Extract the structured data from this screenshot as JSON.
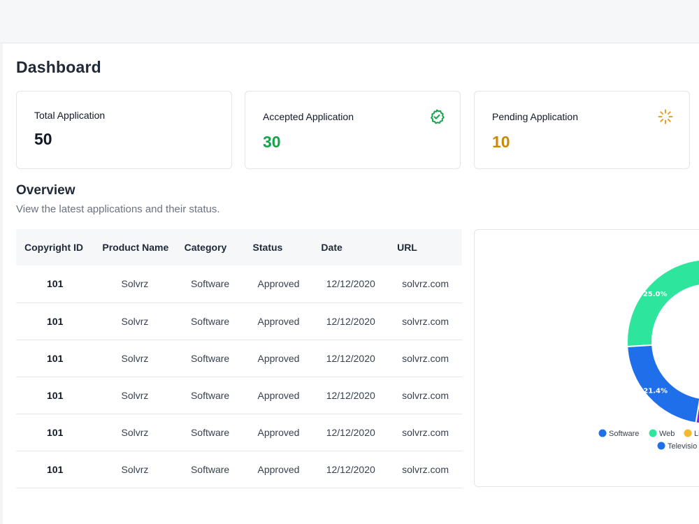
{
  "page": {
    "title": "Dashboard"
  },
  "stats": [
    {
      "label": "Total Application",
      "value": "50",
      "color": "#111827"
    },
    {
      "label": "Accepted Application",
      "value": "30",
      "color": "#16a34a",
      "icon": "check-badge-icon"
    },
    {
      "label": "Pending Application",
      "value": "10",
      "color": "#ca8a04",
      "icon": "loader-icon"
    }
  ],
  "overview": {
    "title": "Overview",
    "subtitle": "View the latest applications and their status."
  },
  "table": {
    "columns": [
      "Copyright ID",
      "Product Name",
      "Category",
      "Status",
      "Date",
      "URL"
    ],
    "rows": [
      [
        "101",
        "Solvrz",
        "Software",
        "Approved",
        "12/12/2020",
        "solvrz.com"
      ],
      [
        "101",
        "Solvrz",
        "Software",
        "Approved",
        "12/12/2020",
        "solvrz.com"
      ],
      [
        "101",
        "Solvrz",
        "Software",
        "Approved",
        "12/12/2020",
        "solvrz.com"
      ],
      [
        "101",
        "Solvrz",
        "Software",
        "Approved",
        "12/12/2020",
        "solvrz.com"
      ],
      [
        "101",
        "Solvrz",
        "Software",
        "Approved",
        "12/12/2020",
        "solvrz.com"
      ],
      [
        "101",
        "Solvrz",
        "Software",
        "Approved",
        "12/12/2020",
        "solvrz.com"
      ]
    ]
  },
  "chart_data": {
    "type": "pie",
    "series": [
      {
        "name": "Web",
        "value": 25.0,
        "label": "25.0%",
        "color": "#2ee59d"
      },
      {
        "name": "Software",
        "value": 21.4,
        "label": "21.4%",
        "color": "#1f6feb"
      },
      {
        "name": "Li",
        "value": 12.0,
        "label": "",
        "color": "#8b1ee0"
      },
      {
        "name": "Televisio",
        "value": 41.6,
        "label": "",
        "color": "#1f6feb"
      }
    ],
    "legend": [
      "Software",
      "Web",
      "Li",
      "Televisio"
    ],
    "legend_colors": [
      "#1f6feb",
      "#2ee59d",
      "#f5b82e",
      "#1f6feb"
    ]
  }
}
